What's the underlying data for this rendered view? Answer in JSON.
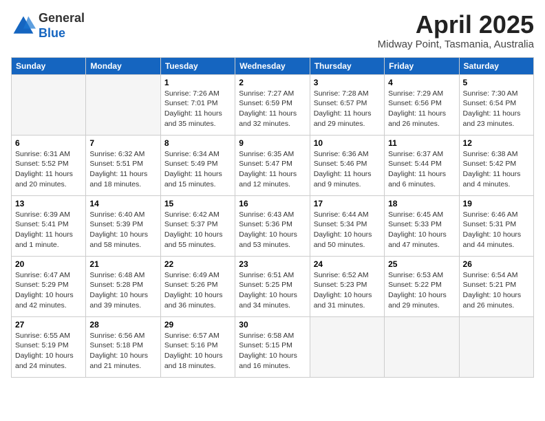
{
  "header": {
    "logo_general": "General",
    "logo_blue": "Blue",
    "month_title": "April 2025",
    "subtitle": "Midway Point, Tasmania, Australia"
  },
  "columns": [
    "Sunday",
    "Monday",
    "Tuesday",
    "Wednesday",
    "Thursday",
    "Friday",
    "Saturday"
  ],
  "weeks": [
    [
      {
        "day": "",
        "info": ""
      },
      {
        "day": "",
        "info": ""
      },
      {
        "day": "1",
        "info": "Sunrise: 7:26 AM\nSunset: 7:01 PM\nDaylight: 11 hours and 35 minutes."
      },
      {
        "day": "2",
        "info": "Sunrise: 7:27 AM\nSunset: 6:59 PM\nDaylight: 11 hours and 32 minutes."
      },
      {
        "day": "3",
        "info": "Sunrise: 7:28 AM\nSunset: 6:57 PM\nDaylight: 11 hours and 29 minutes."
      },
      {
        "day": "4",
        "info": "Sunrise: 7:29 AM\nSunset: 6:56 PM\nDaylight: 11 hours and 26 minutes."
      },
      {
        "day": "5",
        "info": "Sunrise: 7:30 AM\nSunset: 6:54 PM\nDaylight: 11 hours and 23 minutes."
      }
    ],
    [
      {
        "day": "6",
        "info": "Sunrise: 6:31 AM\nSunset: 5:52 PM\nDaylight: 11 hours and 20 minutes."
      },
      {
        "day": "7",
        "info": "Sunrise: 6:32 AM\nSunset: 5:51 PM\nDaylight: 11 hours and 18 minutes."
      },
      {
        "day": "8",
        "info": "Sunrise: 6:34 AM\nSunset: 5:49 PM\nDaylight: 11 hours and 15 minutes."
      },
      {
        "day": "9",
        "info": "Sunrise: 6:35 AM\nSunset: 5:47 PM\nDaylight: 11 hours and 12 minutes."
      },
      {
        "day": "10",
        "info": "Sunrise: 6:36 AM\nSunset: 5:46 PM\nDaylight: 11 hours and 9 minutes."
      },
      {
        "day": "11",
        "info": "Sunrise: 6:37 AM\nSunset: 5:44 PM\nDaylight: 11 hours and 6 minutes."
      },
      {
        "day": "12",
        "info": "Sunrise: 6:38 AM\nSunset: 5:42 PM\nDaylight: 11 hours and 4 minutes."
      }
    ],
    [
      {
        "day": "13",
        "info": "Sunrise: 6:39 AM\nSunset: 5:41 PM\nDaylight: 11 hours and 1 minute."
      },
      {
        "day": "14",
        "info": "Sunrise: 6:40 AM\nSunset: 5:39 PM\nDaylight: 10 hours and 58 minutes."
      },
      {
        "day": "15",
        "info": "Sunrise: 6:42 AM\nSunset: 5:37 PM\nDaylight: 10 hours and 55 minutes."
      },
      {
        "day": "16",
        "info": "Sunrise: 6:43 AM\nSunset: 5:36 PM\nDaylight: 10 hours and 53 minutes."
      },
      {
        "day": "17",
        "info": "Sunrise: 6:44 AM\nSunset: 5:34 PM\nDaylight: 10 hours and 50 minutes."
      },
      {
        "day": "18",
        "info": "Sunrise: 6:45 AM\nSunset: 5:33 PM\nDaylight: 10 hours and 47 minutes."
      },
      {
        "day": "19",
        "info": "Sunrise: 6:46 AM\nSunset: 5:31 PM\nDaylight: 10 hours and 44 minutes."
      }
    ],
    [
      {
        "day": "20",
        "info": "Sunrise: 6:47 AM\nSunset: 5:29 PM\nDaylight: 10 hours and 42 minutes."
      },
      {
        "day": "21",
        "info": "Sunrise: 6:48 AM\nSunset: 5:28 PM\nDaylight: 10 hours and 39 minutes."
      },
      {
        "day": "22",
        "info": "Sunrise: 6:49 AM\nSunset: 5:26 PM\nDaylight: 10 hours and 36 minutes."
      },
      {
        "day": "23",
        "info": "Sunrise: 6:51 AM\nSunset: 5:25 PM\nDaylight: 10 hours and 34 minutes."
      },
      {
        "day": "24",
        "info": "Sunrise: 6:52 AM\nSunset: 5:23 PM\nDaylight: 10 hours and 31 minutes."
      },
      {
        "day": "25",
        "info": "Sunrise: 6:53 AM\nSunset: 5:22 PM\nDaylight: 10 hours and 29 minutes."
      },
      {
        "day": "26",
        "info": "Sunrise: 6:54 AM\nSunset: 5:21 PM\nDaylight: 10 hours and 26 minutes."
      }
    ],
    [
      {
        "day": "27",
        "info": "Sunrise: 6:55 AM\nSunset: 5:19 PM\nDaylight: 10 hours and 24 minutes."
      },
      {
        "day": "28",
        "info": "Sunrise: 6:56 AM\nSunset: 5:18 PM\nDaylight: 10 hours and 21 minutes."
      },
      {
        "day": "29",
        "info": "Sunrise: 6:57 AM\nSunset: 5:16 PM\nDaylight: 10 hours and 18 minutes."
      },
      {
        "day": "30",
        "info": "Sunrise: 6:58 AM\nSunset: 5:15 PM\nDaylight: 10 hours and 16 minutes."
      },
      {
        "day": "",
        "info": ""
      },
      {
        "day": "",
        "info": ""
      },
      {
        "day": "",
        "info": ""
      }
    ]
  ]
}
